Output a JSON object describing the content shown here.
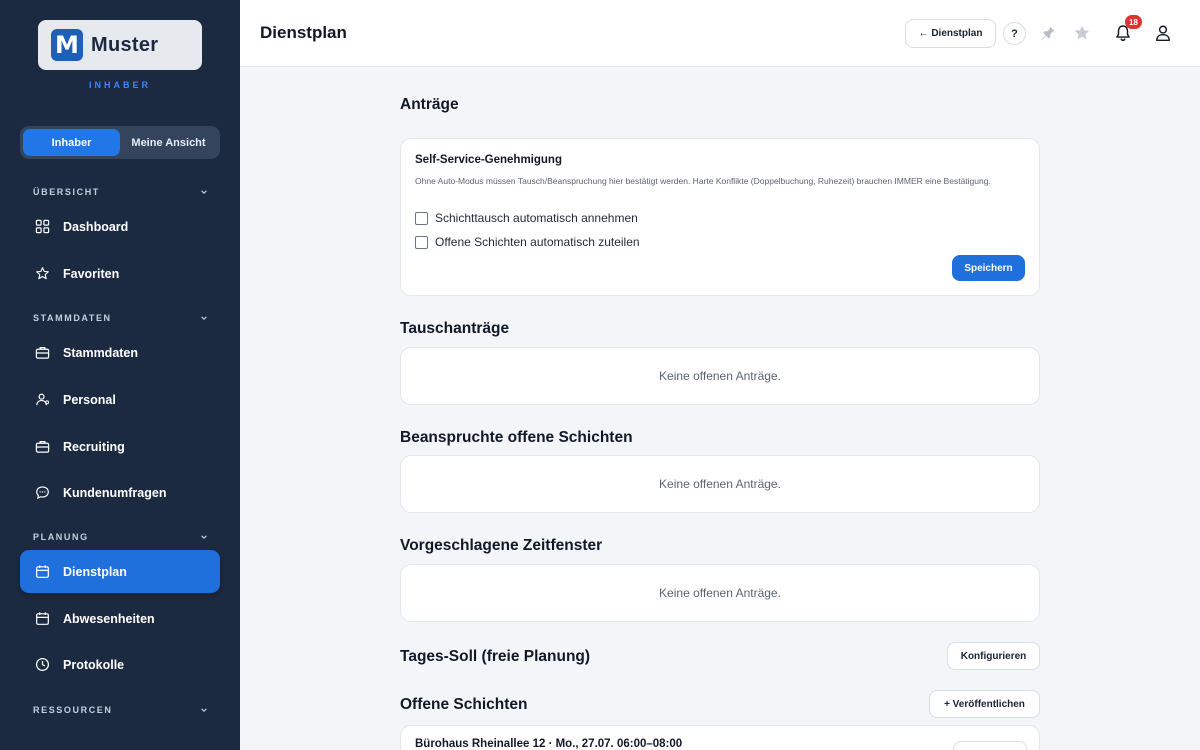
{
  "sidebar": {
    "logo_text": "Muster",
    "logo_letter": "M",
    "role_label": "INHABER",
    "view_toggle": {
      "left": "Inhaber",
      "right": "Meine Ansicht"
    },
    "sections": {
      "overview": "ÜBERSICHT",
      "masterdata": "STAMMDATEN",
      "planning": "PLANUNG",
      "resources": "RESSOURCEN"
    },
    "items": {
      "dashboard": "Dashboard",
      "favorites": "Favoriten",
      "masterdata": "Stammdaten",
      "staff": "Personal",
      "recruiting": "Recruiting",
      "surveys": "Kundenumfragen",
      "schedule": "Dienstplan",
      "absences": "Abwesenheiten",
      "logs": "Protokolle"
    }
  },
  "header": {
    "title": "Dienstplan",
    "back_button": "← Dienstplan",
    "help": "?",
    "notification_count": "18"
  },
  "main": {
    "requests_heading": "Anträge",
    "self_service": {
      "title": "Self-Service-Genehmigung",
      "description": "Ohne Auto-Modus müssen Tausch/Beanspruchung hier bestätigt werden. Harte Konflikte (Doppelbuchung, Ruhezeit) brauchen IMMER eine Bestätigung.",
      "option_swap": "Schichttausch automatisch annehmen",
      "option_open": "Offene Schichten automatisch zuteilen",
      "save_button": "Speichern"
    },
    "swap_heading": "Tauschanträge",
    "swap_empty": "Keine offenen Anträge.",
    "claimed_heading": "Beanspruchte offene Schichten",
    "claimed_empty": "Keine offenen Anträge.",
    "suggested_heading": "Vorgeschlagene Zeitfenster",
    "suggested_empty": "Keine offenen Anträge.",
    "daily_target_heading": "Tages-Soll (freie Planung)",
    "configure_button": "Konfigurieren",
    "open_shifts_heading": "Offene Schichten",
    "publish_button": "+ Veröffentlichen",
    "open_shift_item": "Bürohaus Rheinallee 12 · Mo., 27.07. 06:00–08:00"
  },
  "colors": {
    "sidebar_bg": "#1b2a41",
    "accent": "#1f6fdc",
    "badge": "#e0322f"
  }
}
